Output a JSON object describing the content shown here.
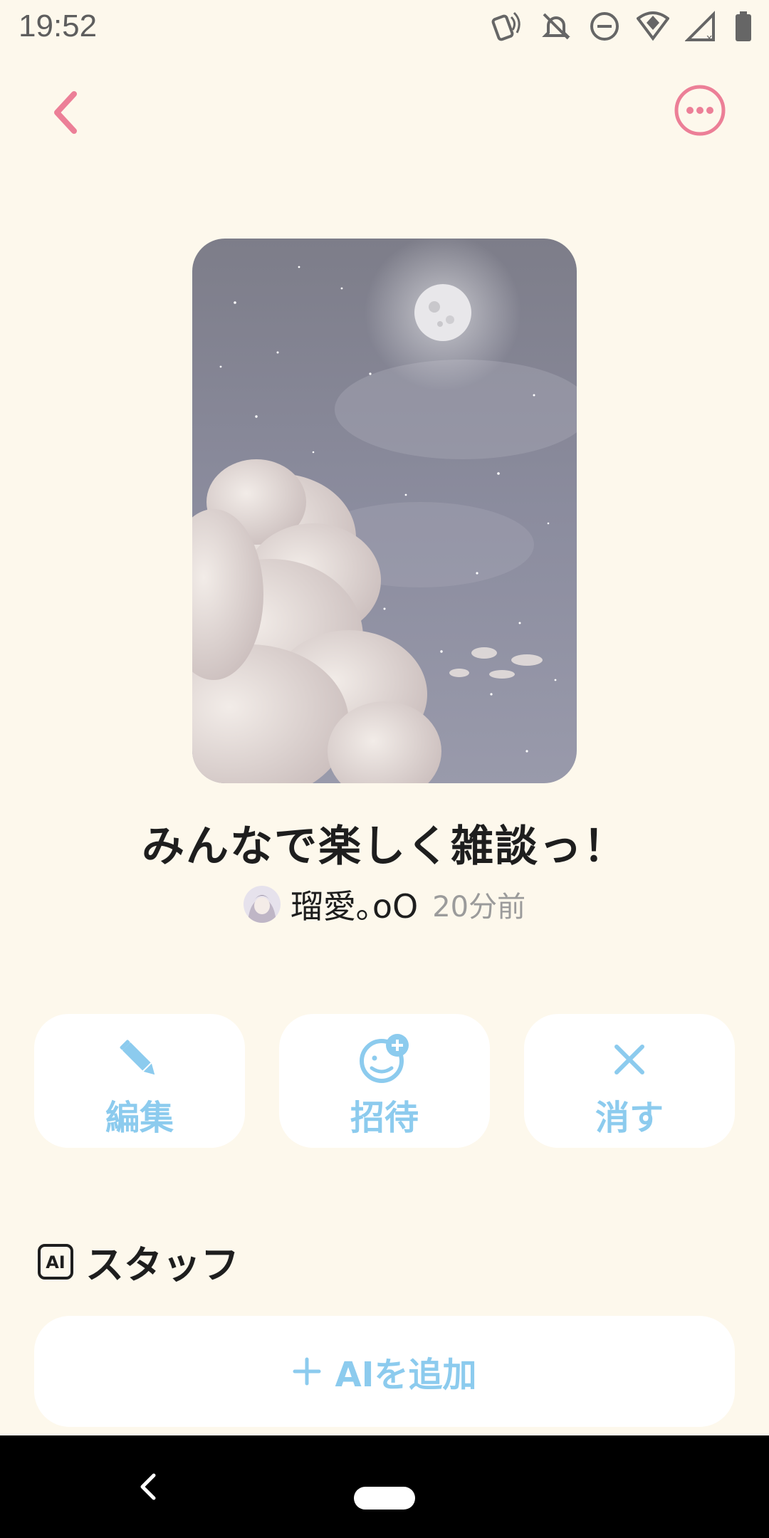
{
  "status": {
    "time": "19:52",
    "icons": [
      "nfc-icon",
      "bell-off-icon",
      "do-not-disturb-icon",
      "wifi-icon",
      "signal-icon",
      "battery-icon"
    ]
  },
  "header": {
    "back_icon": "chevron-left-icon",
    "more_icon": "more-circle-icon"
  },
  "room": {
    "title": "みんなで楽しく雑談っ！",
    "owner_name": "瑠愛｡oO",
    "posted": "20分前"
  },
  "actions": [
    {
      "label": "編集",
      "icon": "pencil-icon"
    },
    {
      "label": "招待",
      "icon": "invite-face-icon"
    },
    {
      "label": "消す",
      "icon": "close-icon"
    }
  ],
  "staff": {
    "title": "スタッフ",
    "badge": "AI",
    "add_label": "AIを追加"
  },
  "colors": {
    "background": "#fdf8ec",
    "accent_pink": "#ec7f97",
    "accent_blue": "#8ccbee",
    "card": "#ffffff"
  }
}
